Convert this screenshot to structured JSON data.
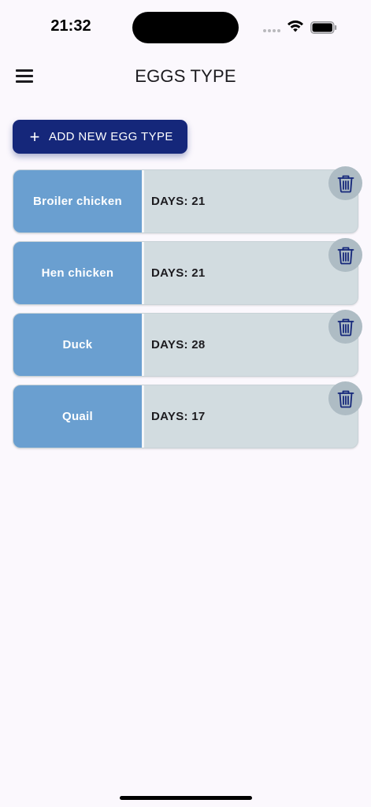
{
  "status_bar": {
    "time": "21:32"
  },
  "app_bar": {
    "title": "EGGS TYPE"
  },
  "add_button": {
    "plus": "+",
    "label": "ADD NEW EGG TYPE"
  },
  "eggs": [
    {
      "name": "Broiler chicken",
      "days": "DAYS: 21"
    },
    {
      "name": "Hen chicken",
      "days": "DAYS: 21"
    },
    {
      "name": "Duck",
      "days": "DAYS: 28"
    },
    {
      "name": "Quail",
      "days": "DAYS: 17"
    }
  ],
  "colors": {
    "background": "#fbf8fd",
    "primary": "#15277a",
    "name_panel": "#6a9fd0",
    "card": "#d2dce0",
    "delete_circle": "#aebcc4"
  },
  "icons": {
    "menu": "hamburger-menu-icon",
    "delete": "trash-icon",
    "wifi": "wifi-icon",
    "battery": "battery-icon",
    "signal": "cellular-signal-icon"
  }
}
